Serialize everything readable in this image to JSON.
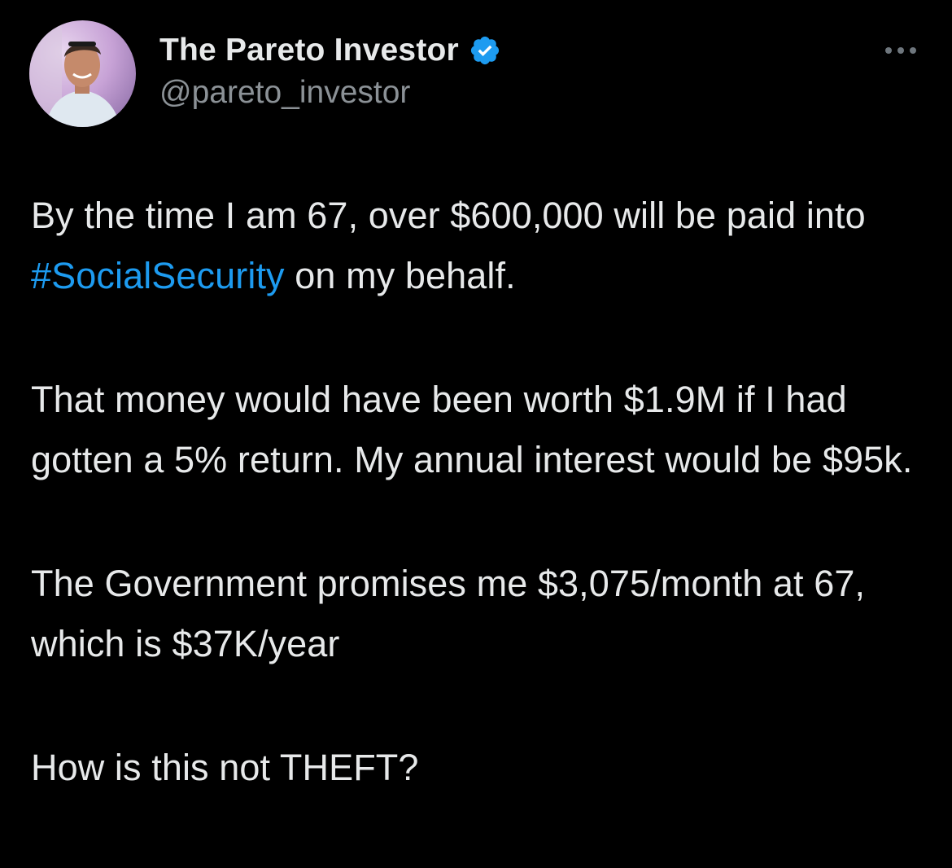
{
  "author": {
    "display_name": "The Pareto Investor",
    "handle": "@pareto_investor",
    "verified": true,
    "avatar_icon": "profile-photo",
    "verified_icon": "verified-badge-icon"
  },
  "menu": {
    "icon": "more-options-icon"
  },
  "tweet": {
    "p1_a": "By the time I am 67, over $600,000 will be paid into ",
    "p1_hashtag": "#SocialSecurity",
    "p1_b": " on my behalf.",
    "p2": "That money would have been worth $1.9M if I had gotten a 5% return. My annual interest would be $95k.",
    "p3": "The Government promises me $3,075/month at 67, which is $37K/year",
    "p4": "How is this not THEFT?"
  },
  "colors": {
    "background": "#000000",
    "text": "#e7e9ea",
    "secondary_text": "#8b9196",
    "link": "#1d9bf0",
    "verified": "#1d9bf0"
  }
}
